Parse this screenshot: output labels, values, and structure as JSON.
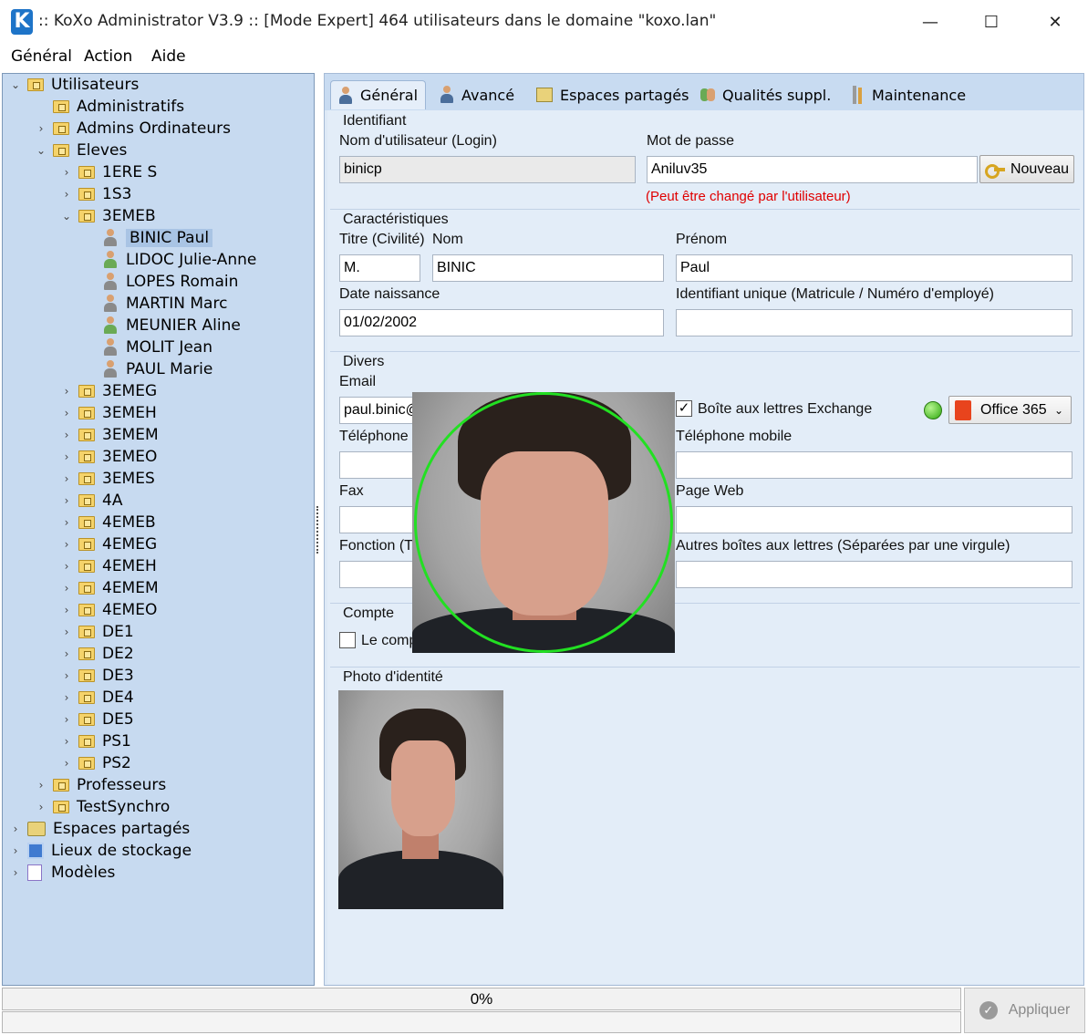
{
  "window": {
    "title": ":: KoXo Administrator V3.9 :: [Mode Expert] 464 utilisateurs dans le domaine \"koxo.lan\"",
    "logo": "K",
    "controls": {
      "minimize": "—",
      "maximize": "☐",
      "close": "✕"
    }
  },
  "menu": [
    "Général",
    "Action",
    "Aide"
  ],
  "tree": {
    "root": "Utilisateurs",
    "groups": [
      "Administratifs",
      "Admins Ordinateurs"
    ],
    "eleves": "Eleves",
    "classes_before": [
      "1ERE S",
      "1S3"
    ],
    "open_class": "3EMEB",
    "users": [
      {
        "name": "BINIC Paul",
        "selected": true,
        "variant": "gray"
      },
      {
        "name": "LIDOC Julie-Anne",
        "variant": "green"
      },
      {
        "name": "LOPES Romain",
        "variant": "gray"
      },
      {
        "name": "MARTIN Marc",
        "variant": "gray"
      },
      {
        "name": "MEUNIER Aline",
        "variant": "green"
      },
      {
        "name": "MOLIT Jean",
        "variant": "gray"
      },
      {
        "name": "PAUL Marie",
        "variant": "gray"
      }
    ],
    "classes_after": [
      "3EMEG",
      "3EMEH",
      "3EMEM",
      "3EMEO",
      "3EMES",
      "4A",
      "4EMEB",
      "4EMEG",
      "4EMEH",
      "4EMEM",
      "4EMEO",
      "DE1",
      "DE2",
      "DE3",
      "DE4",
      "DE5",
      "PS1",
      "PS2"
    ],
    "groups_after": [
      "Professeurs",
      "TestSynchro"
    ],
    "roots_after": [
      "Espaces partagés",
      "Lieux de stockage",
      "Modèles"
    ],
    "icons": {
      "expand": "›",
      "collapse": "⌄"
    }
  },
  "tabs": [
    "Général",
    "Avancé",
    "Espaces partagés",
    "Qualités suppl.",
    "Maintenance"
  ],
  "identifiant": {
    "title": "Identifiant",
    "login_label": "Nom d'utilisateur (Login)",
    "login_value": "binicp",
    "password_label": "Mot de passe",
    "password_value": "Aniluv35",
    "new_button": "Nouveau",
    "password_note": "(Peut être changé par l'utilisateur)"
  },
  "caracteristiques": {
    "title": "Caractéristiques",
    "titre_label": "Titre (Civilité)",
    "titre_value": "M.",
    "nom_label": "Nom",
    "nom_value": "BINIC",
    "prenom_label": "Prénom",
    "prenom_value": "Paul",
    "dob_label": "Date naissance",
    "dob_value": "01/02/2002",
    "uid_label": "Identifiant unique (Matricule / Numéro d'employé)",
    "uid_value": ""
  },
  "divers": {
    "title": "Divers",
    "email_label": "Email",
    "email_value": "paul.binic@",
    "exchange_label": "Boîte aux lettres Exchange",
    "exchange_checked": "✓",
    "office_select": "Office 365",
    "phone_label": "Téléphone",
    "mobile_label": "Téléphone mobile",
    "fax_label": "Fax",
    "web_label": "Page Web",
    "function_label": "Fonction (T",
    "other_mailboxes_label": "Autres boîtes aux lettres (Séparées par une virgule)"
  },
  "compte": {
    "title": "Compte",
    "checkbox_label": "Le comp"
  },
  "photo": {
    "title": "Photo d'identité"
  },
  "footer": {
    "progress_text": "0%",
    "progress": 0,
    "apply_button": "Appliquer",
    "apply_icon": "✓"
  },
  "colors": {
    "status_ok": "#2ea80f",
    "warning_text": "#e00000",
    "focus_ring": "#22e022"
  }
}
